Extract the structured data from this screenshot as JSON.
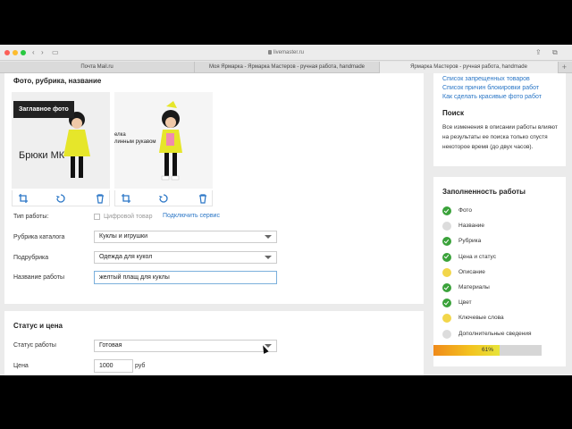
{
  "browser": {
    "url": "livemaster.ru",
    "tabs": [
      {
        "label": "Почта Mail.ru",
        "active": false
      },
      {
        "label": "Моя Ярмарка - Ярмарка Мастеров - ручная работа, handmade",
        "active": false
      },
      {
        "label": "Ярмарка Мастеров - ручная работа, handmade",
        "active": true
      }
    ]
  },
  "main": {
    "section_title": "Фото, рубрика, название",
    "photo1": {
      "badge": "Заглавное фото",
      "caption": "Брюки МК"
    },
    "photo2": {
      "caption_line1": "елка",
      "caption_line2": "линным рукавом"
    },
    "type_label": "Тип работы:",
    "digital_label": "Цифровой товар",
    "connect_link": "Подключить сервис",
    "catalog_label": "Рубрика каталога",
    "catalog_value": "Куклы и игрушки",
    "subcatalog_label": "Подрубрика",
    "subcatalog_value": "Одежда для кукол",
    "name_label": "Название работы",
    "name_value": "желтый плащ для куклы"
  },
  "status": {
    "section_title": "Статус и цена",
    "status_label": "Статус работы",
    "status_value": "Готовая",
    "price_label": "Цена",
    "price_value": "1000",
    "currency": "руб"
  },
  "sidebar": {
    "links": [
      "Список запрещенных товаров",
      "Список причин блокировки работ",
      "Как сделать красивые фото работ"
    ],
    "search_title": "Поиск",
    "search_text": "Все изменения в описании работы влияют на результаты ее поиска только спустя некоторое время (до двух часов).",
    "completeness_title": "Заполненность работы",
    "items": [
      {
        "label": "Фото",
        "state": "green"
      },
      {
        "label": "Название",
        "state": "gray"
      },
      {
        "label": "Рубрика",
        "state": "green"
      },
      {
        "label": "Цена и статус",
        "state": "green"
      },
      {
        "label": "Описание",
        "state": "yellow"
      },
      {
        "label": "Материалы",
        "state": "green"
      },
      {
        "label": "Цвет",
        "state": "green"
      },
      {
        "label": "Ключевые слова",
        "state": "yellow"
      },
      {
        "label": "Дополнительные сведения",
        "state": "gray"
      }
    ],
    "progress_label": "61%",
    "progress_value": 0.61
  },
  "colors": {
    "link": "#2a76c6",
    "ok": "#3aa23a",
    "warn": "#f2d64a",
    "pending": "#dcdcdc"
  }
}
